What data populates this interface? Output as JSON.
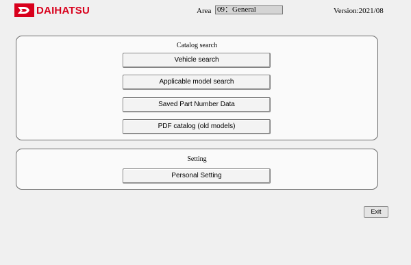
{
  "header": {
    "brand": "DAIHATSU",
    "area_label": "Area",
    "area_value": "09：General",
    "version": "Version:2021/08"
  },
  "catalog_search": {
    "title": "Catalog search",
    "buttons": [
      "Vehicle search",
      "Applicable model search",
      "Saved Part Number Data",
      "PDF catalog (old models)"
    ]
  },
  "setting": {
    "title": "Setting",
    "buttons": [
      "Personal Setting"
    ]
  },
  "exit_label": "Exit",
  "colors": {
    "brand_red": "#d8001c",
    "background": "#f0f0f0"
  }
}
